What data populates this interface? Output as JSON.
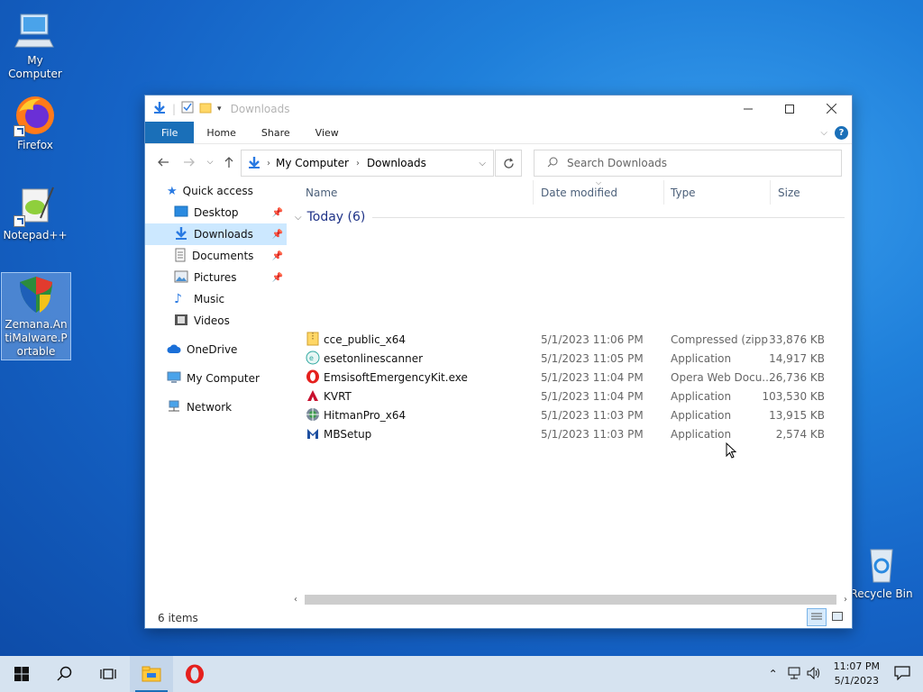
{
  "desktop": {
    "icons": [
      {
        "label": "My Computer"
      },
      {
        "label": "Firefox"
      },
      {
        "label": "Notepad++"
      },
      {
        "label": "Zemana.AntiMalware.Portable"
      },
      {
        "label": "Recycle Bin"
      }
    ]
  },
  "window": {
    "title": "Downloads",
    "ribbon_tabs": [
      "File",
      "Home",
      "Share",
      "View"
    ],
    "address": {
      "root": "My Computer",
      "current": "Downloads"
    },
    "search_placeholder": "Search Downloads",
    "nav": {
      "quick_access": "Quick access",
      "items": [
        "Desktop",
        "Downloads",
        "Documents",
        "Pictures",
        "Music",
        "Videos"
      ],
      "onedrive": "OneDrive",
      "my_computer": "My Computer",
      "network": "Network"
    },
    "columns": {
      "name": "Name",
      "date": "Date modified",
      "type": "Type",
      "size": "Size"
    },
    "group": "Today (6)",
    "files": [
      {
        "name": "cce_public_x64",
        "date": "5/1/2023 11:06 PM",
        "type": "Compressed (zipp...",
        "size": "33,876 KB",
        "icon": "zip-icon"
      },
      {
        "name": "esetonlinescanner",
        "date": "5/1/2023 11:05 PM",
        "type": "Application",
        "size": "14,917 KB",
        "icon": "eset-icon"
      },
      {
        "name": "EmsisoftEmergencyKit.exe",
        "date": "5/1/2023 11:04 PM",
        "type": "Opera Web Docu...",
        "size": "26,736 KB",
        "icon": "opera-icon"
      },
      {
        "name": "KVRT",
        "date": "5/1/2023 11:04 PM",
        "type": "Application",
        "size": "103,530 KB",
        "icon": "kvrt-icon"
      },
      {
        "name": "HitmanPro_x64",
        "date": "5/1/2023 11:03 PM",
        "type": "Application",
        "size": "13,915 KB",
        "icon": "hitman-icon"
      },
      {
        "name": "MBSetup",
        "date": "5/1/2023 11:03 PM",
        "type": "Application",
        "size": "2,574 KB",
        "icon": "mb-icon"
      }
    ],
    "status": "6 items"
  },
  "taskbar": {
    "time": "11:07 PM",
    "date": "5/1/2023"
  }
}
